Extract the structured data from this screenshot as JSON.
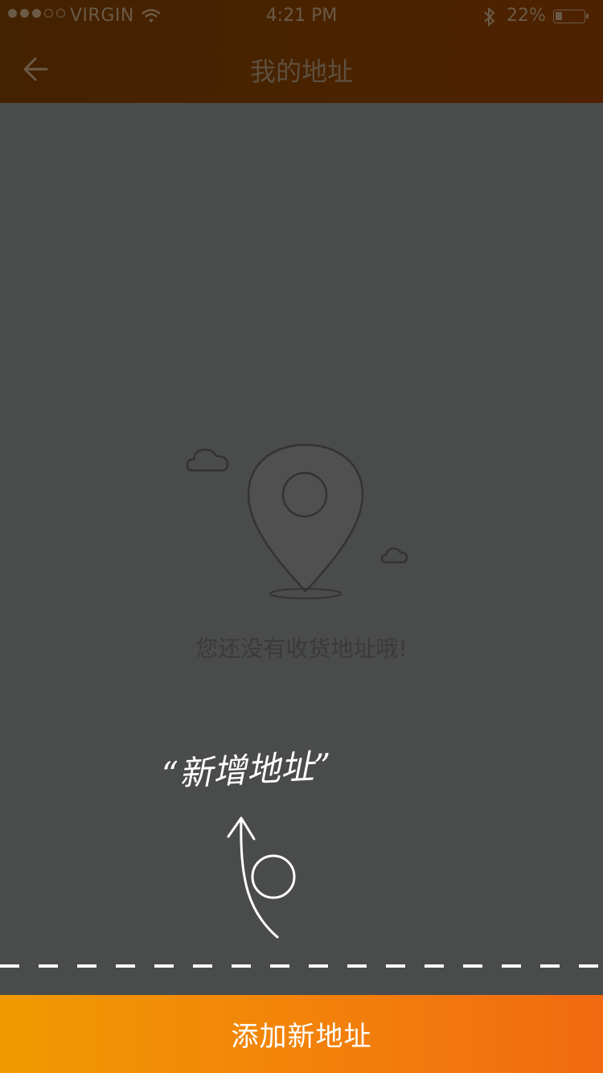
{
  "status_bar": {
    "carrier": "VIRGIN",
    "signal_bars_filled": 3,
    "signal_bars_total": 5,
    "time": "4:21 PM",
    "battery_percent": "22%",
    "icons": [
      "signal-dots-icon",
      "wifi-icon",
      "bluetooth-icon",
      "battery-icon"
    ]
  },
  "header": {
    "title": "我的地址",
    "back_icon": "back-arrow-icon"
  },
  "empty_state": {
    "icon": "location-pin-icon",
    "decorations": [
      "cloud-icon",
      "cloud-icon"
    ],
    "message": "您还没有收货地址哦!"
  },
  "annotation": {
    "handwritten_text": "“新增地址”",
    "arrow_icon": "hand-drawn-arrow-icon"
  },
  "bottom": {
    "add_button_label": "添加新地址"
  },
  "colors": {
    "header_bg": "#462200",
    "overlay_bg": "#4a4b4b",
    "button_start": "#f19a00",
    "button_end": "#f26a0f",
    "button_text": "#ffffff",
    "dashed_line": "#ffffff"
  }
}
